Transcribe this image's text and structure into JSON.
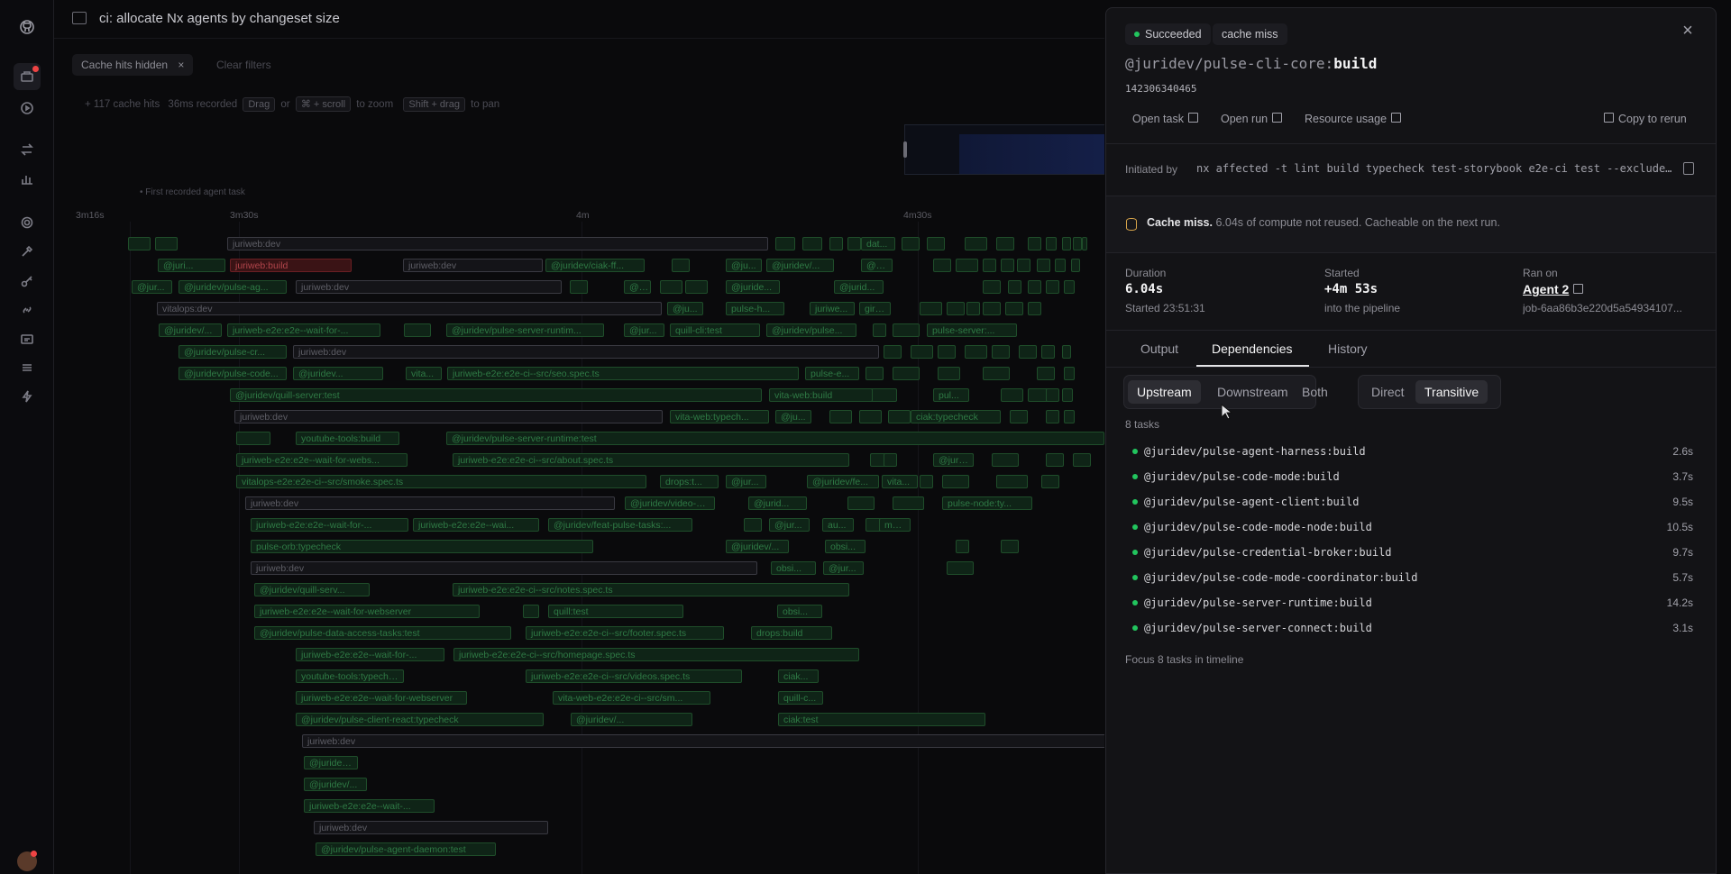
{
  "header": {
    "title": "ci: allocate Nx agents by changeset size"
  },
  "filters": {
    "active_chip": "Cache hits hidden",
    "clear_label": "Clear filters"
  },
  "hint": {
    "count_text": "+ 117 cache hits",
    "recorded": "36ms recorded",
    "drag": "Drag",
    "or": "or",
    "scroll_key": "⌘ + scroll",
    "to_zoom": "to zoom",
    "pan_key": "Shift + drag",
    "to_pan": "to pan"
  },
  "timeline": {
    "first_label": "• First recorded agent task",
    "axis": [
      "3m16s",
      "3m30s",
      "4m",
      "4m30s"
    ],
    "bars": [
      "juriweb:dev",
      "dat...",
      "@juri...",
      "juriweb:build",
      "juriweb:dev",
      "@juridev/ciak-ff...",
      "@ju...",
      "@juridev/...",
      "@ju...",
      "@jur...",
      "@juridev/pulse-ag...",
      "juriweb:dev",
      "@j...",
      "@juride...",
      "@jurid...",
      "vitalops:dev",
      "@ju...",
      "pulse-h...",
      "juriwe...",
      "gira...",
      "@juridev/...",
      "juriweb-e2e:e2e--wait-for-...",
      "@juridev/pulse-server-runtim...",
      "@jur...",
      "quill-cli:test",
      "@juridev/pulse...",
      "pulse-server:...",
      "@juridev/pulse-cr...",
      "juriweb:dev",
      "@juridev/pulse-code...",
      "@juridev...",
      "vita...",
      "juriweb-e2e:e2e-ci--src/seo.spec.ts",
      "pulse-e...",
      "@juridev/quill-server:test",
      "vita-web:build",
      "pul...",
      "juriweb:dev",
      "vita-web:typech...",
      "@ju...",
      "ciak:typecheck",
      "youtube-tools:build",
      "@juridev/pulse-server-runtime:test",
      "juriweb-e2e:e2e--wait-for-webs...",
      "juriweb-e2e:e2e-ci--src/about.spec.ts",
      "@juri...",
      "vitalops-e2e:e2e-ci--src/smoke.spec.ts",
      "drops:t...",
      "@jur...",
      "@juridev/fe...",
      "vita...",
      "juriweb:dev",
      "@juridev/video-mani...",
      "@jurid...",
      "pulse-node:ty...",
      "juriweb-e2e:e2e--wait-for-...",
      "juriweb-e2e:e2e--wai...",
      "@juridev/feat-pulse-tasks:...",
      "@jur...",
      "au...",
      "me...",
      "pulse-orb:typecheck",
      "@juridev/...",
      "obsi...",
      "juriweb:dev",
      "obsi...",
      "@jur...",
      "@juridev/quill-serv...",
      "juriweb-e2e:e2e-ci--src/notes.spec.ts",
      "juriweb-e2e:e2e--wait-for-webserver",
      "quill:test",
      "obsi...",
      "@juridev/pulse-data-access-tasks:test",
      "juriweb-e2e:e2e-ci--src/footer.spec.ts",
      "drops:build",
      "juriweb-e2e:e2e--wait-for-...",
      "juriweb-e2e:e2e-ci--src/homepage.spec.ts",
      "youtube-tools:typecheck",
      "juriweb-e2e:e2e-ci--src/videos.spec.ts",
      "ciak...",
      "juriweb-e2e:e2e--wait-for-webserver",
      "vita-web-e2e:e2e-ci--src/sm...",
      "quill-c...",
      "@juridev/pulse-client-react:typecheck",
      "@juridev/...",
      "ciak:test",
      "juriweb:dev",
      "@juridev...",
      "@juridev/...",
      "juriweb-e2e:e2e--wait-...",
      "juriweb:dev",
      "@juridev/pulse-agent-daemon:test"
    ]
  },
  "panel": {
    "status_badge": "Succeeded",
    "cache_badge": "cache miss",
    "close_icon": "close-icon",
    "task_scope": "@juridev/pulse-cli-core:",
    "task_target": "build",
    "task_id": "142306340465",
    "links": {
      "open_task": "Open task",
      "open_run": "Open run",
      "resource_usage": "Resource usage",
      "copy_to_rerun": "Copy to rerun"
    },
    "initiated_label": "Initiated by",
    "initiated_cmd": "nx affected -t lint build typecheck test-storybook e2e-ci test --exclude...",
    "cache": {
      "title": "Cache miss.",
      "text": "6.04s of compute not reused. Cacheable on the next run."
    },
    "meta": {
      "duration_label": "Duration",
      "duration_value": "6.04s",
      "duration_sub": "Started 23:51:31",
      "started_label": "Started",
      "started_value": "+4m 53s",
      "started_sub": "into the pipeline",
      "ran_on_label": "Ran on",
      "ran_on_value": "Agent 2",
      "ran_on_sub": "job-6aa86b3e220d5a54934107..."
    },
    "tabs": [
      "Output",
      "Dependencies",
      "History"
    ],
    "active_tab": "Dependencies",
    "direction": [
      "Upstream",
      "Downstream",
      "Both"
    ],
    "direction_selected": "Upstream",
    "depth": [
      "Direct",
      "Transitive"
    ],
    "depth_selected": "Transitive",
    "task_count": "8 tasks",
    "dependencies": [
      {
        "name": "@juridev/pulse-agent-harness:build",
        "duration": "2.6s"
      },
      {
        "name": "@juridev/pulse-code-mode:build",
        "duration": "3.7s"
      },
      {
        "name": "@juridev/pulse-agent-client:build",
        "duration": "9.5s"
      },
      {
        "name": "@juridev/pulse-code-mode-node:build",
        "duration": "10.5s"
      },
      {
        "name": "@juridev/pulse-credential-broker:build",
        "duration": "9.7s"
      },
      {
        "name": "@juridev/pulse-code-mode-coordinator:build",
        "duration": "5.7s"
      },
      {
        "name": "@juridev/pulse-server-runtime:build",
        "duration": "14.2s"
      },
      {
        "name": "@juridev/pulse-server-connect:build",
        "duration": "3.1s"
      }
    ],
    "focus_link": "Focus 8 tasks in timeline"
  },
  "colors": {
    "success": "#22c55e",
    "cache_miss_icon": "#d4a24a",
    "bar_green": "#2f7a45",
    "bar_red": "#b0454b"
  }
}
